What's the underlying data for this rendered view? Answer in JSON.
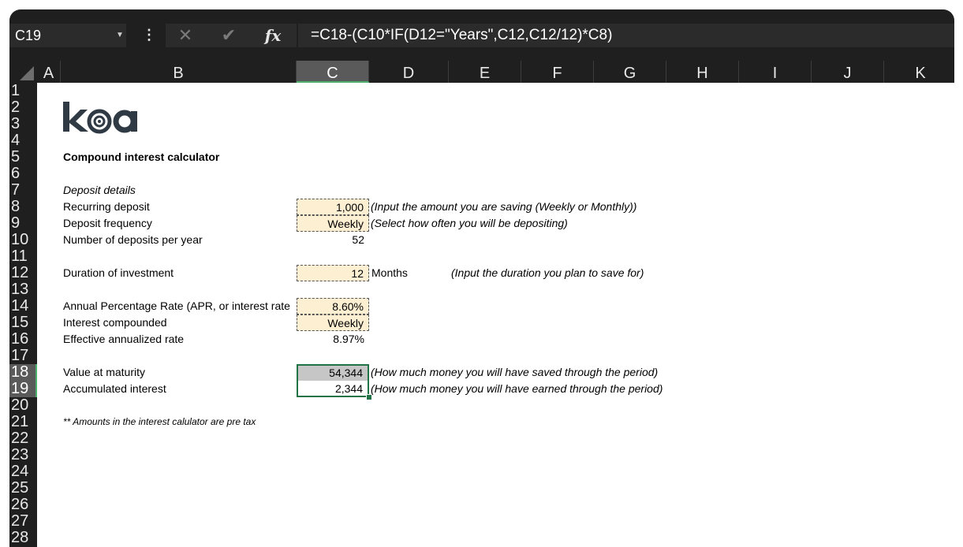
{
  "formula_bar": {
    "name_box": "C19",
    "formula": "=C18-(C10*IF(D12=\"Years\",C12,C12/12)*C8)"
  },
  "columns": [
    "A",
    "B",
    "C",
    "D",
    "E",
    "F",
    "G",
    "H",
    "I",
    "J",
    "K"
  ],
  "selected_column": "C",
  "rows": [
    "1",
    "2",
    "3",
    "4",
    "5",
    "6",
    "7",
    "8",
    "9",
    "10",
    "11",
    "12",
    "13",
    "14",
    "15",
    "16",
    "17",
    "18",
    "19",
    "20",
    "21",
    "22",
    "23",
    "24",
    "25",
    "26",
    "27",
    "28"
  ],
  "selected_rows": [
    "18",
    "19"
  ],
  "sheet": {
    "logo_text": "koa",
    "title": "Compound interest calculator",
    "deposit_details": "Deposit details",
    "recurring_deposit": {
      "label": "Recurring deposit",
      "value": "1,000",
      "note": "(Input the amount you are saving (Weekly or Monthly))"
    },
    "deposit_frequency": {
      "label": "Deposit frequency",
      "value": "Weekly",
      "note": "(Select how often you will be depositing)"
    },
    "deposits_per_year": {
      "label": "Number of deposits per year",
      "value": "52"
    },
    "duration": {
      "label": "Duration of investment",
      "value": "12",
      "unit": "Months",
      "note": "(Input the duration you plan to save for)"
    },
    "apr": {
      "label": "Annual Percentage Rate (APR, or interest rate",
      "value": "8.60%"
    },
    "compounded": {
      "label": "Interest compounded",
      "value": "Weekly"
    },
    "effective_rate": {
      "label": "Effective annualized rate",
      "value": "8.97%"
    },
    "maturity": {
      "label": "Value at maturity",
      "value": "54,344",
      "note": "(How much money you will have saved through the period)"
    },
    "interest": {
      "label": "Accumulated interest",
      "value": "2,344",
      "note": "(How much money you will have earned through the period)"
    },
    "footnote": "** Amounts in the interest calulator are pre tax"
  },
  "colors": {
    "input_fill": "#fdefd2",
    "selected_fill": "#c6c6c6",
    "selection_border": "#217346",
    "dark_chrome": "#1f1f1f"
  }
}
